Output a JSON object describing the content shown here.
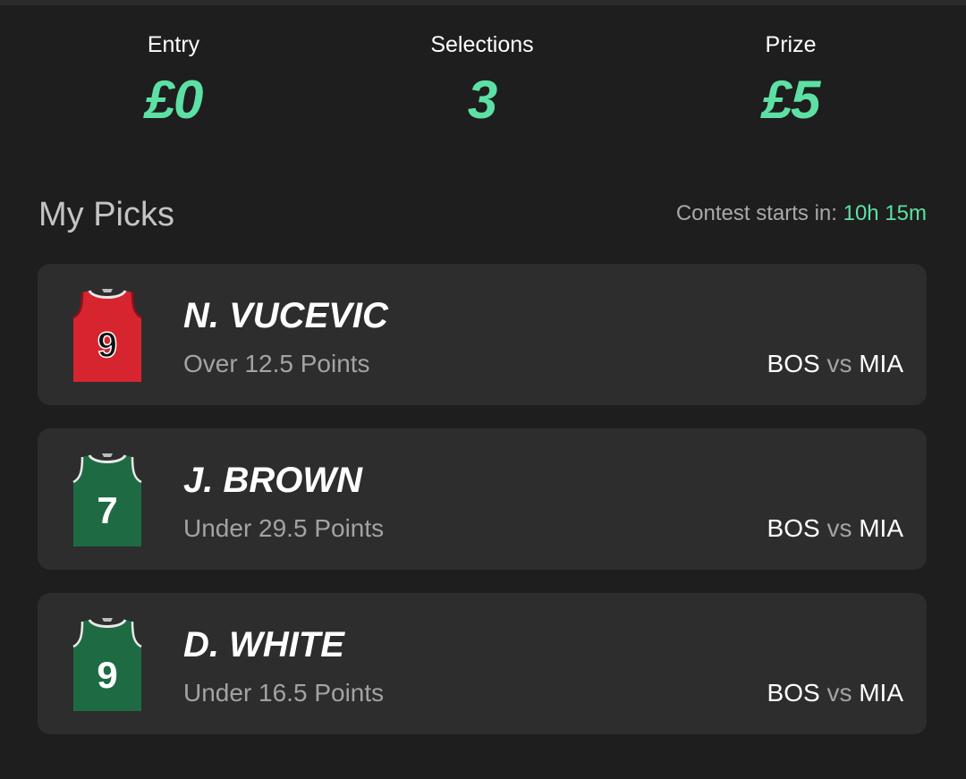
{
  "stats": {
    "entry": {
      "label": "Entry",
      "value": "£0"
    },
    "selections": {
      "label": "Selections",
      "value": "3"
    },
    "prize": {
      "label": "Prize",
      "value": "£5"
    }
  },
  "picks_section": {
    "title": "My Picks",
    "countdown_label": "Contest starts in:",
    "countdown_value": "10h 15m"
  },
  "picks": [
    {
      "player": "N. VUCEVIC",
      "line": "Over 12.5 Points",
      "home": "BOS",
      "vs": "vs",
      "away": "MIA",
      "jersey_number": "9",
      "jersey_color": "#d6252e",
      "jersey_icon": "red-jersey-icon"
    },
    {
      "player": "J. BROWN",
      "line": "Under 29.5 Points",
      "home": "BOS",
      "vs": "vs",
      "away": "MIA",
      "jersey_number": "7",
      "jersey_color": "#1e6b43",
      "jersey_icon": "green-jersey-icon"
    },
    {
      "player": "D. WHITE",
      "line": "Under 16.5 Points",
      "home": "BOS",
      "vs": "vs",
      "away": "MIA",
      "jersey_number": "9",
      "jersey_color": "#1e6b43",
      "jersey_icon": "green-jersey-icon"
    }
  ],
  "colors": {
    "background": "#1e1e1e",
    "card": "#2d2d2d",
    "accent": "#5de0a4",
    "muted_text": "#a3a3a3"
  }
}
